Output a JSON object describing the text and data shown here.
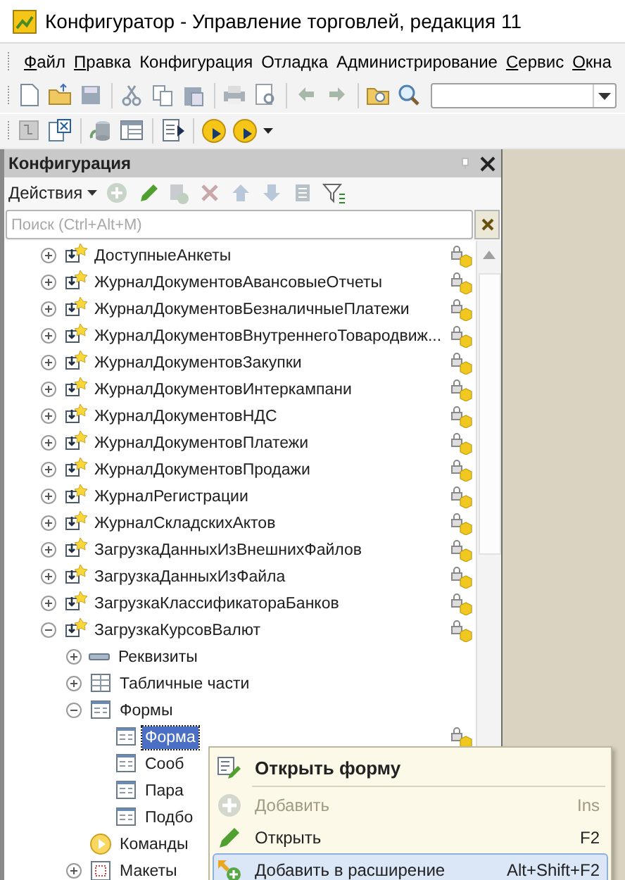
{
  "window": {
    "title": "Конфигуратор - Управление торговлей, редакция 11"
  },
  "menu": [
    {
      "label": "Файл",
      "mnemonic": true
    },
    {
      "label": "Правка",
      "mnemonic": true
    },
    {
      "label": "Конфигурация",
      "mnemonic": false
    },
    {
      "label": "Отладка",
      "mnemonic": false
    },
    {
      "label": "Администрирование",
      "mnemonic": false
    },
    {
      "label": "Сервис",
      "mnemonic": true
    },
    {
      "label": "Окна",
      "mnemonic": true
    }
  ],
  "panel": {
    "title": "Конфигурация",
    "actions_label": "Действия",
    "search": {
      "placeholder": "Поиск (Ctrl+Alt+M)"
    }
  },
  "tree": [
    {
      "label": "ДоступныеАнкеты",
      "kind": "object",
      "expanded": false,
      "locked": true,
      "selected": false
    },
    {
      "label": "ЖурналДокументовАвансовыеОтчеты",
      "kind": "object",
      "expanded": false,
      "locked": true,
      "selected": false
    },
    {
      "label": "ЖурналДокументовБезналичныеПлатежи",
      "kind": "object",
      "expanded": false,
      "locked": true,
      "selected": false
    },
    {
      "label": "ЖурналДокументовВнутреннегоТовародвиж...",
      "kind": "object",
      "expanded": false,
      "locked": true,
      "selected": false
    },
    {
      "label": "ЖурналДокументовЗакупки",
      "kind": "object",
      "expanded": false,
      "locked": true,
      "selected": false
    },
    {
      "label": "ЖурналДокументовИнтеркампани",
      "kind": "object",
      "expanded": false,
      "locked": true,
      "selected": false
    },
    {
      "label": "ЖурналДокументовНДС",
      "kind": "object",
      "expanded": false,
      "locked": true,
      "selected": false
    },
    {
      "label": "ЖурналДокументовПлатежи",
      "kind": "object",
      "expanded": false,
      "locked": true,
      "selected": false
    },
    {
      "label": "ЖурналДокументовПродажи",
      "kind": "object",
      "expanded": false,
      "locked": true,
      "selected": false
    },
    {
      "label": "ЖурналРегистрации",
      "kind": "object",
      "expanded": false,
      "locked": true,
      "selected": false
    },
    {
      "label": "ЖурналСкладскихАктов",
      "kind": "object",
      "expanded": false,
      "locked": true,
      "selected": false
    },
    {
      "label": "ЗагрузкаДанныхИзВнешнихФайлов",
      "kind": "object",
      "expanded": false,
      "locked": true,
      "selected": false
    },
    {
      "label": "ЗагрузкаДанныхИзФайла",
      "kind": "object",
      "expanded": false,
      "locked": true,
      "selected": false
    },
    {
      "label": "ЗагрузкаКлассификатораБанков",
      "kind": "object",
      "expanded": false,
      "locked": true,
      "selected": false
    },
    {
      "label": "ЗагрузкаКурсовВалют",
      "kind": "object",
      "expanded": true,
      "locked": true,
      "selected": false,
      "children": [
        {
          "label": "Реквизиты",
          "kind": "attributes",
          "expanded": false,
          "selected": false
        },
        {
          "label": "Табличные части",
          "kind": "tabular",
          "expanded": false,
          "selected": false
        },
        {
          "label": "Формы",
          "kind": "forms",
          "expanded": true,
          "selected": false,
          "children": [
            {
              "label": "Форма",
              "kind": "form",
              "locked": true,
              "selected": true
            },
            {
              "label": "Сооб",
              "kind": "form",
              "selected": false
            },
            {
              "label": "Пара",
              "kind": "form",
              "selected": false
            },
            {
              "label": "Подбо",
              "kind": "form",
              "selected": false
            }
          ]
        },
        {
          "label": "Команды",
          "kind": "commands",
          "selected": false
        },
        {
          "label": "Макеты",
          "kind": "templates",
          "expanded": false,
          "selected": false
        }
      ]
    }
  ],
  "context_menu": [
    {
      "kind": "header",
      "label": "Открыть форму",
      "disabled": false,
      "selected": false
    },
    {
      "kind": "add",
      "label": "Добавить",
      "shortcut": "Ins",
      "disabled": true,
      "selected": false
    },
    {
      "kind": "open",
      "label": "Открыть",
      "shortcut": "F2",
      "disabled": false,
      "selected": false
    },
    {
      "kind": "extend",
      "label": "Добавить в расширение",
      "shortcut": "Alt+Shift+F2",
      "disabled": false,
      "selected": true
    }
  ]
}
